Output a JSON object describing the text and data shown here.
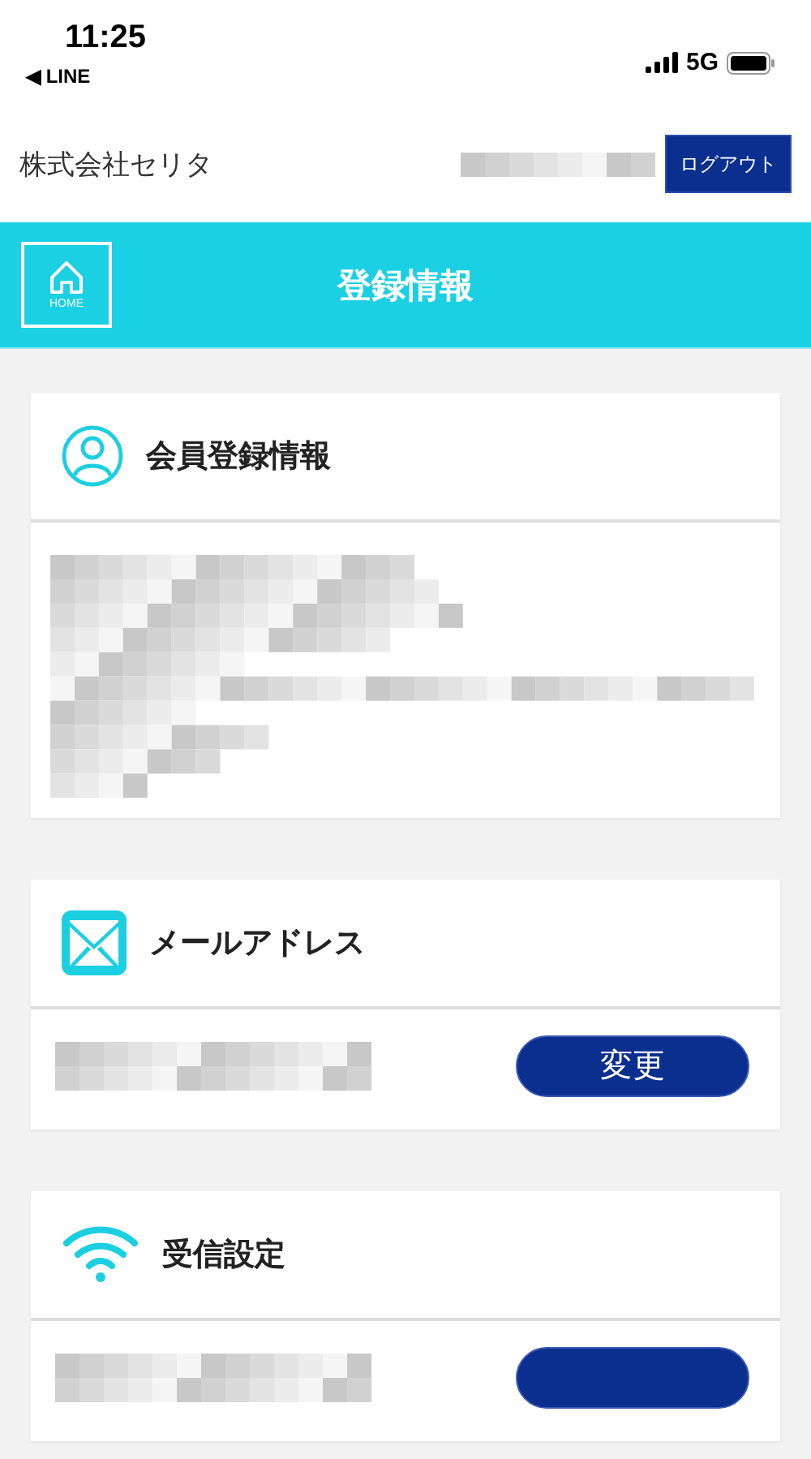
{
  "status_bar": {
    "time": "11:25",
    "back_app": "◀ LINE",
    "network": "5G"
  },
  "header": {
    "company": "株式会社セリタ",
    "logout_button": "ログアウト"
  },
  "title_bar": {
    "home_label": "HOME",
    "title": "登録情報"
  },
  "cards": [
    {
      "kind": "member",
      "title": "会員登録情報"
    },
    {
      "kind": "mail",
      "title": "メールアドレス",
      "button": "変更"
    },
    {
      "kind": "receive",
      "title": "受信設定"
    }
  ]
}
